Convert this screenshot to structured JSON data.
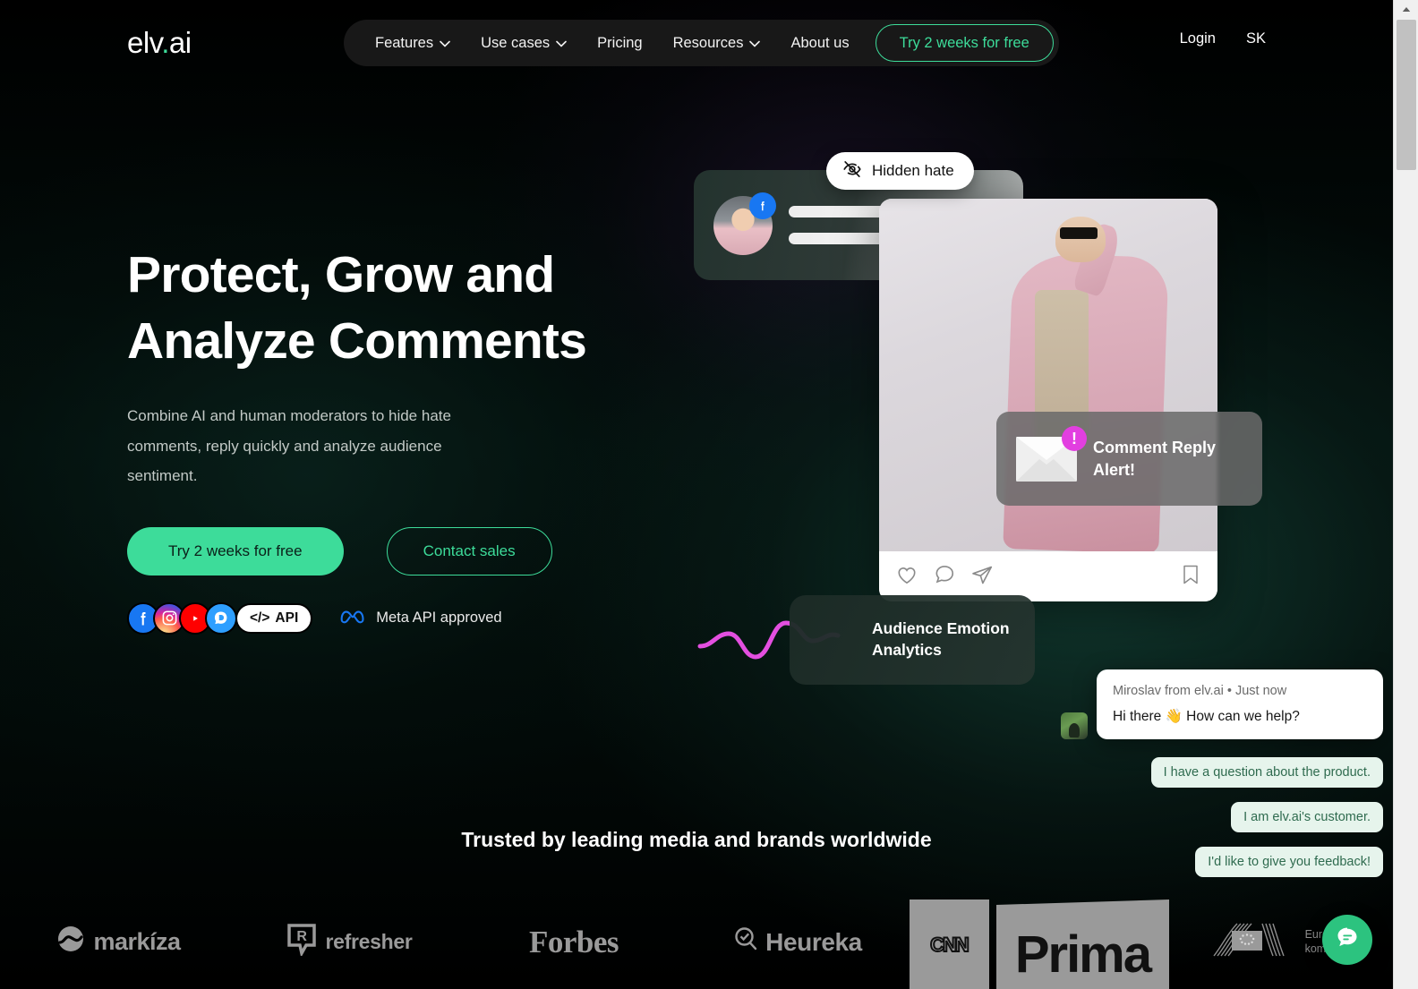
{
  "brand": {
    "logo_text": "elv",
    "logo_dot": ".",
    "logo_suffix": "ai"
  },
  "nav": {
    "items": [
      {
        "label": "Features",
        "has_caret": true
      },
      {
        "label": "Use cases",
        "has_caret": true
      },
      {
        "label": "Pricing",
        "has_caret": false
      },
      {
        "label": "Resources",
        "has_caret": true
      },
      {
        "label": "About us",
        "has_caret": false
      }
    ],
    "cta_label": "Try 2 weeks for free",
    "login_label": "Login",
    "language_label": "SK"
  },
  "hero": {
    "headline_line1": "Protect, Grow and",
    "headline_line2": "Analyze Comments",
    "subhead": "Combine AI and human moderators to hide hate comments, reply quickly and analyze audience sentiment.",
    "primary_cta": "Try 2 weeks for free",
    "secondary_cta": "Contact sales",
    "social": {
      "facebook": "f",
      "instagram": "instagram-icon",
      "youtube": "youtube-icon",
      "disqus": "D",
      "api_label": "API",
      "api_glyph": "</>",
      "meta_label": "Meta API approved"
    }
  },
  "visuals": {
    "hidden_hate_label": "Hidden hate",
    "alert_title": "Comment Reply Alert!",
    "alert_badge": "!",
    "emotion_title": "Audience Emotion Analytics"
  },
  "chat": {
    "meta": "Miroslav from elv.ai • Just now",
    "message": "Hi there 👋 How can we help?",
    "quick_replies": [
      "I have a question about the product.",
      "I am elv.ai's customer.",
      "I'd like to give you feedback!"
    ]
  },
  "trusted": {
    "title": "Trusted by leading media and brands worldwide",
    "logos": [
      {
        "name": "markíza"
      },
      {
        "name": "refresher",
        "mark": "R"
      },
      {
        "name": "Forbes"
      },
      {
        "name": "Heureka"
      },
      {
        "name": "CNN",
        "second": "Prima"
      },
      {
        "name_line1": "Európska",
        "name_line2": "komisia"
      }
    ]
  },
  "colors": {
    "accent": "#3ddc9a",
    "fab": "#2cc37f",
    "alert_badge": "#e23fe0",
    "wave": "#e34fe0",
    "chip_bg": "#e6f4ec",
    "chip_text": "#2f6b4f"
  }
}
